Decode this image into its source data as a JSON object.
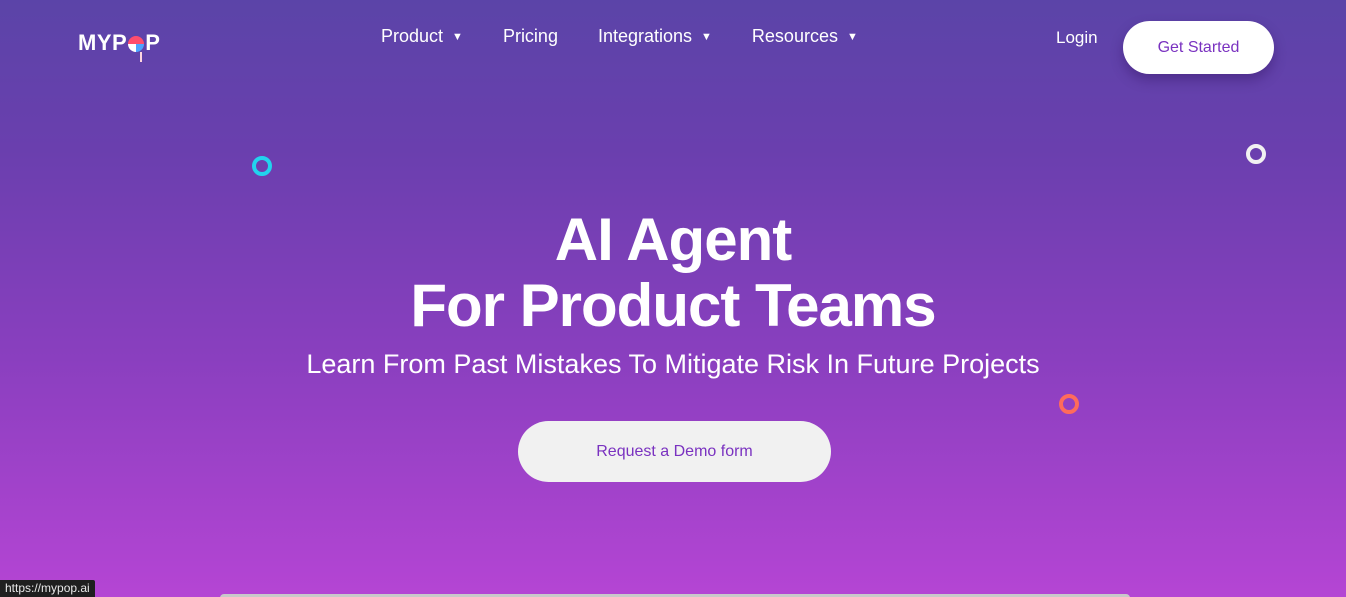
{
  "header": {
    "logo_text_left": "MYP",
    "logo_text_right": "P",
    "nav": [
      {
        "label": "Product",
        "has_caret": true
      },
      {
        "label": "Pricing",
        "has_caret": false
      },
      {
        "label": "Integrations",
        "has_caret": true
      },
      {
        "label": "Resources",
        "has_caret": true
      }
    ],
    "caret_glyph": "▼",
    "login_label": "Login",
    "get_started_label": "Get Started"
  },
  "hero": {
    "title_line1": "AI Agent",
    "title_line2": "For Product Teams",
    "subtitle": "Learn From Past Mistakes To Mitigate Risk In Future Projects",
    "demo_button_label": "Request a Demo form"
  },
  "status_bar": {
    "url": "https://mypop.ai"
  },
  "colors": {
    "brand_purple": "#7a32c0",
    "ring_cyan": "#22d3ee",
    "ring_white": "#f1f1f1",
    "ring_orange": "#ff6b5b"
  }
}
